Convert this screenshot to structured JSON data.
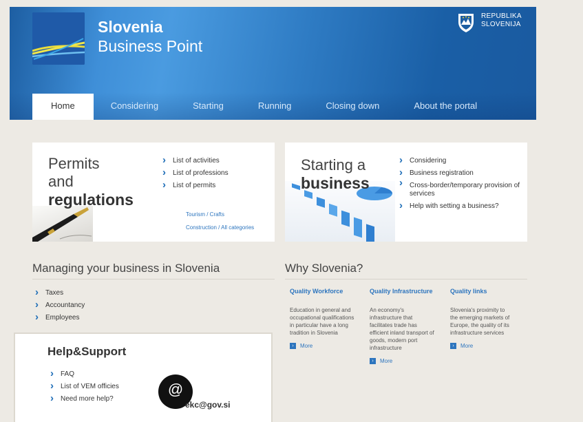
{
  "header": {
    "brand_line1": "Slovenia",
    "brand_line2": "Business Point",
    "republika_line1": "REPUBLIKA",
    "republika_line2": "SLOVENIJA"
  },
  "nav": {
    "tabs": [
      {
        "label": "Home",
        "active": true
      },
      {
        "label": "Considering"
      },
      {
        "label": "Starting"
      },
      {
        "label": "Running"
      },
      {
        "label": "Closing down"
      },
      {
        "label": "About the portal"
      }
    ]
  },
  "permits": {
    "title_line1": "Permits",
    "title_line2": "and",
    "title_line3": "regulations",
    "links": [
      "List of activities",
      "List of professions",
      "List of permits"
    ],
    "sub1": "Tourism / Crafts",
    "sub2": "Construction / All categories"
  },
  "starting": {
    "title_line1": "Starting a",
    "title_line2": "business",
    "links": [
      "Considering",
      "Business registration",
      "Cross-border/temporary provision of services",
      "Help with setting a business?"
    ]
  },
  "managing": {
    "heading": "Managing your business in Slovenia",
    "links": [
      "Taxes",
      "Accountancy",
      "Employees"
    ]
  },
  "help": {
    "title": "Help&Support",
    "links": [
      "FAQ",
      "List of VEM officies",
      "Need more help?"
    ],
    "at_symbol": "@",
    "email": "ekc@gov.si"
  },
  "why": {
    "heading": "Why Slovenia?",
    "columns": [
      {
        "title": "Quality Workforce",
        "desc": "Education in general and occupational qualifications in particular have a long tradition in Slovenia",
        "more": "More"
      },
      {
        "title": "Quality Infrastructure",
        "desc": "An economy's infrastructure that facilitates trade has efficient inland transport of goods, modern port infrastructure",
        "more": "More"
      },
      {
        "title": "Quality links",
        "desc": "Slovenia's proximity to the emerging markets of Europe, the quality of its infrastructure services",
        "more": "More"
      }
    ]
  },
  "colors": {
    "accent": "#2d75be",
    "header": "#2f7cc4",
    "background": "#edeae4"
  }
}
